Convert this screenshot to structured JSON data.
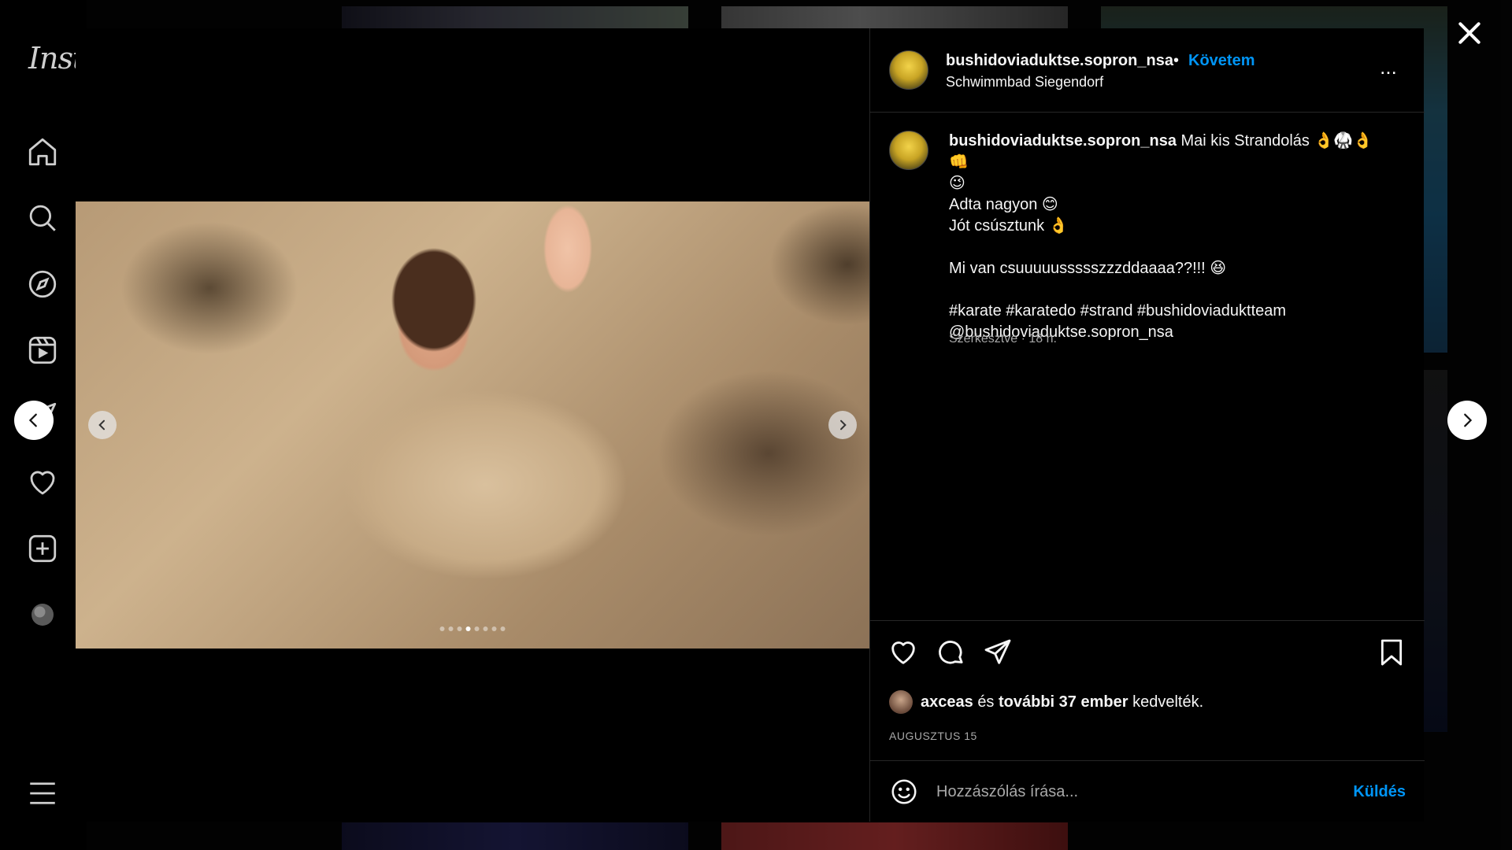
{
  "app": {
    "logo_text": "Inst"
  },
  "nav": {
    "icons": [
      "home-icon",
      "search-icon",
      "explore-icon",
      "reels-icon",
      "messages-icon",
      "notifications-icon",
      "create-icon",
      "profile-icon",
      "menu-icon"
    ]
  },
  "post": {
    "username": "bushidoviaduktse.sopron_nsa",
    "separator": "•",
    "follow_label": "Követem",
    "location": "Schwimmbad Siegendorf",
    "more_label": "...",
    "caption": {
      "first_line": "Mai kis Strandolás 👌🥋👌👊",
      "line2": "😉",
      "line3": "Adta nagyon 😊",
      "line4": "Jót csúsztunk 👌",
      "line5": "Mi van csuuuuussssszzzddaaaa??!!! 😆",
      "line6": "#karate #karatedo #strand #bushidoviaduktteam",
      "line7": "@bushidoviaduktse.sopron_nsa"
    },
    "edited_meta": "Szerkesztve · 18 h.",
    "likes": {
      "user": "axceas",
      "and": "és",
      "others": "további 37 ember",
      "suffix": "kedvelték."
    },
    "date": "AUGUSZTUS 15",
    "carousel": {
      "slide_count": 8,
      "active_index": 3
    },
    "comment": {
      "placeholder": "Hozzászólás írása...",
      "send_label": "Küldés"
    }
  },
  "colors": {
    "accent": "#0095f6",
    "background": "#000000",
    "muted": "#a8a8a8"
  }
}
